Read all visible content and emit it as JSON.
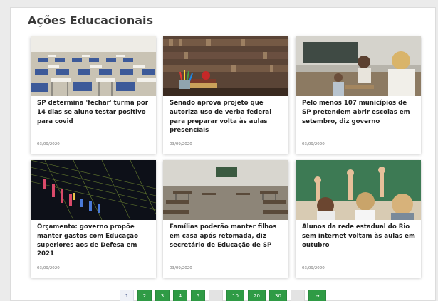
{
  "section": {
    "title": "Ações Educacionais"
  },
  "cards": [
    {
      "headline": "SP determina 'fechar' turma por 14 dias se aluno testar positivo para covid",
      "date": "03/09/2020"
    },
    {
      "headline": "Senado aprova projeto que autoriza uso de verba federal para preparar volta às aulas presenciais",
      "date": "03/09/2020"
    },
    {
      "headline": "Pelo menos 107 municípios de SP pretendem abrir escolas em setembro, diz governo",
      "date": "03/09/2020"
    },
    {
      "headline": "Orçamento: governo propõe manter gastos com Educação superiores aos de Defesa em 2021",
      "date": "03/09/2020"
    },
    {
      "headline": "Famílias poderão manter filhos em casa após retomada, diz secretário de Educação de SP",
      "date": "03/09/2020"
    },
    {
      "headline": "Alunos da rede estadual do Rio sem internet voltam às aulas em outubro",
      "date": "03/09/2020"
    }
  ],
  "pagination": {
    "current": "1",
    "items": [
      "1",
      "2",
      "3",
      "4",
      "5",
      "...",
      "10",
      "20",
      "30",
      "...",
      "→"
    ]
  }
}
